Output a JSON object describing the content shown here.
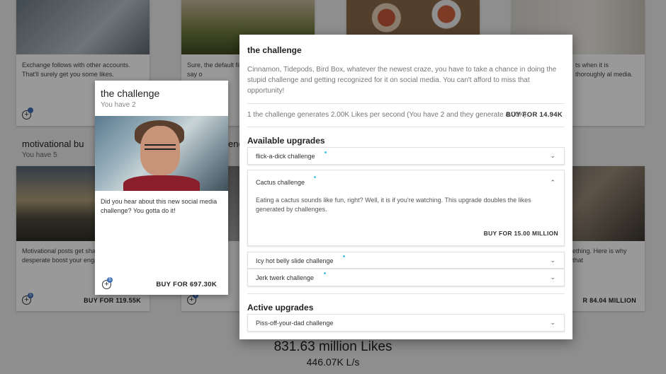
{
  "background": {
    "cards_top": [
      {
        "desc": "Exchange follows with other accounts. That'll surely get you some likes."
      },
      {
        "desc": "Sure, the default fil are no match for th just say o"
      },
      {
        "desc": ""
      },
      {
        "desc": "ts when it is thoroughly al media."
      }
    ],
    "motivational_title": "motivational bu",
    "motivational_owned": "You have 5",
    "partial_heading": "eng",
    "cards_bottom": [
      {
        "desc": "Motivational posts get sha successful and desperate boost your engagements.",
        "buy": "BUY FOR 119.55K",
        "badge": "5"
      },
      {
        "desc": "ou",
        "buy": "",
        "badge": "4"
      },
      {
        "desc": "ething. Here is why that",
        "buy": "R 84.04 MILLION",
        "badge": ""
      }
    ],
    "likes_total": "831.63 million Likes",
    "likes_rate": "446.07K L/s"
  },
  "mini_card": {
    "title": "the challenge",
    "owned": "You have 2",
    "desc": "Did you hear about this new social media challenge? You gotta do it!",
    "buy": "BUY FOR 697.30K",
    "badge": "5",
    "add_icon": "+"
  },
  "modal": {
    "title": "the challenge",
    "desc": "Cinnamon, Tidepods, Bird Box, whatever the newest craze, you have to take a chance in doing the stupid challenge and getting recognized for it on social media. You can't afford to miss that opportunity!",
    "generation": "1 the challenge generates 2.00K Likes per second (You have 2 and they generate 4.00K).",
    "buy": "BUY FOR 14.94K",
    "available_heading": "Available upgrades",
    "active_heading": "Active upgrades",
    "available": [
      {
        "label": "flick-a-dick challenge",
        "expanded": false,
        "chevron": "⌄"
      },
      {
        "label": "Cactus challenge",
        "expanded": true,
        "chevron": "⌃",
        "body": "Eating a cactus sounds like fun, right? Well, it is if you're watching. This upgrade doubles the likes generated by challenges.",
        "buy": "BUY FOR 15.00 MILLION"
      },
      {
        "label": "Icy hot belly slide challenge",
        "expanded": false,
        "chevron": "⌄"
      },
      {
        "label": "Jerk twerk challenge",
        "expanded": false,
        "chevron": "⌄"
      }
    ],
    "active": [
      {
        "label": "Piss-off-your-dad challenge",
        "chevron": "⌄"
      }
    ]
  },
  "colors": {
    "accent_dot": "#46c4e6",
    "badge": "#3f6fb5"
  }
}
